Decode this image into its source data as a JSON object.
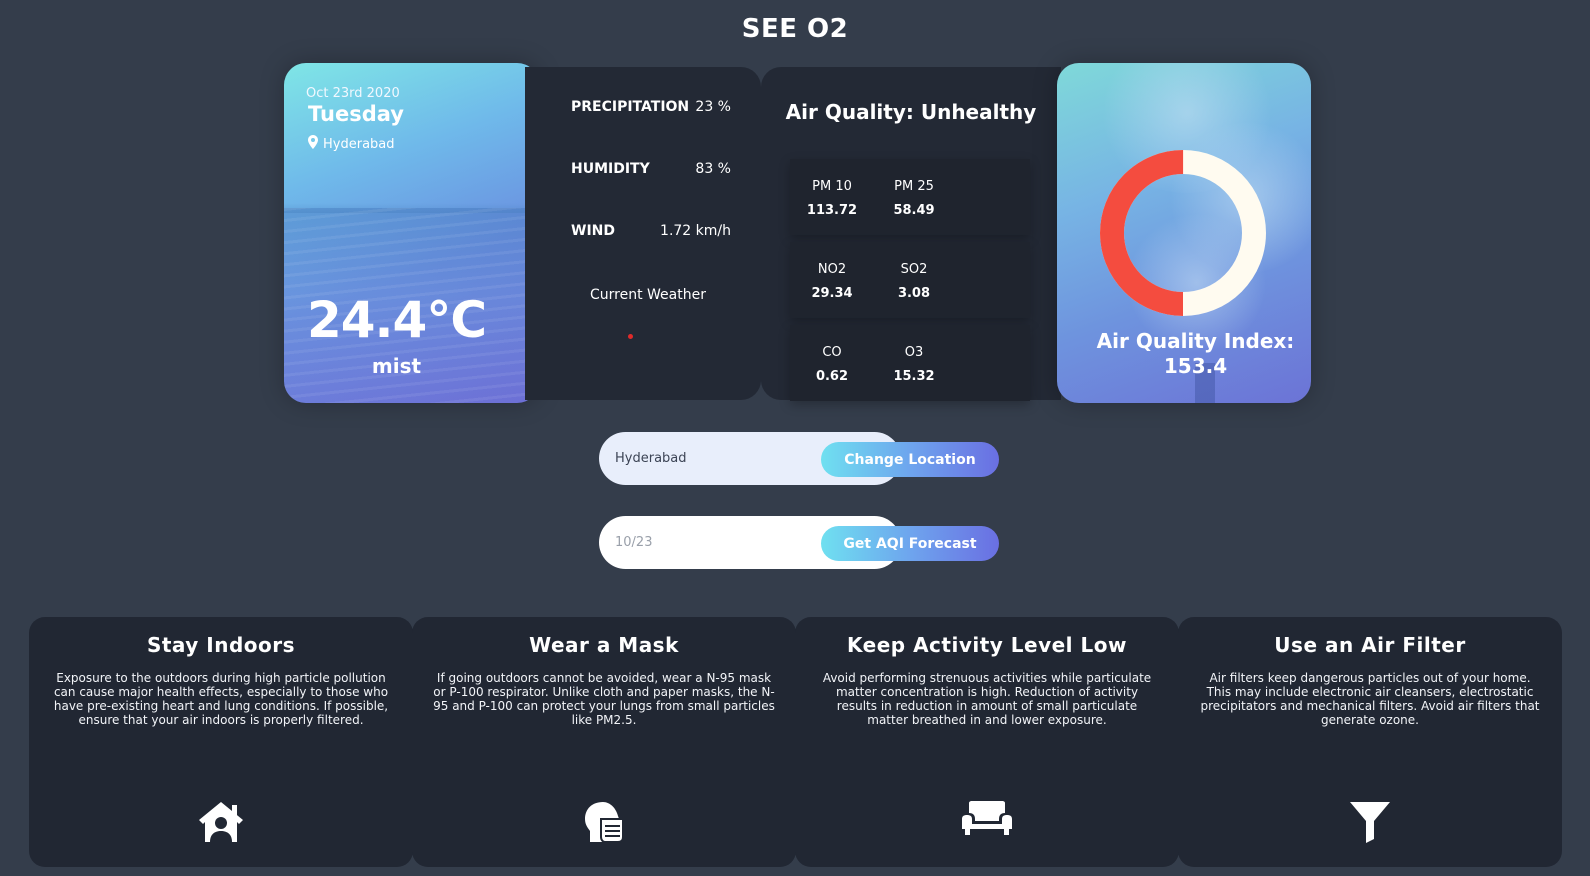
{
  "app": {
    "title": "SEE O2"
  },
  "weather": {
    "date": "Oct 23rd 2020",
    "day": "Tuesday",
    "location": "Hyderabad",
    "temperature": "24.4°C",
    "description": "mist"
  },
  "details": {
    "precipitation_label": "PRECIPITATION",
    "precipitation_value": "23 %",
    "humidity_label": "HUMIDITY",
    "humidity_value": "83 %",
    "wind_label": "WIND",
    "wind_value": "1.72 km/h",
    "current_weather_label": "Current Weather"
  },
  "air_quality": {
    "title": "Air Quality: Unhealthy",
    "pollutants": [
      {
        "name": "PM 10",
        "value": "113.72"
      },
      {
        "name": "PM 25",
        "value": "58.49"
      },
      {
        "name": "NO2",
        "value": "29.34"
      },
      {
        "name": "SO2",
        "value": "3.08"
      },
      {
        "name": "CO",
        "value": "0.62"
      },
      {
        "name": "O3",
        "value": "15.32"
      }
    ]
  },
  "aqi": {
    "label": "Air Quality Index:",
    "value": "153.4",
    "gauge_fraction": 0.5,
    "gauge_color": "#f44c3f",
    "gauge_track_color": "#fffbf0"
  },
  "location_form": {
    "value": "Hyderabad",
    "button_label": "Change Location"
  },
  "forecast_form": {
    "placeholder": "10/23",
    "button_label": "Get AQI Forecast"
  },
  "tips": [
    {
      "title": "Stay Indoors",
      "text": "Exposure to the outdoors during high particle pollution can cause major health effects, especially to those who have pre-existing heart and lung conditions. If possible, ensure that your air indoors is properly filtered.",
      "icon": "house-user-icon"
    },
    {
      "title": "Wear a Mask",
      "text": "If going outdoors cannot be avoided, wear a N-95 mask or P-100 respirator. Unlike cloth and paper masks, the N-95 and P-100 can protect your lungs from small particles like PM2.5.",
      "icon": "head-mask-icon"
    },
    {
      "title": "Keep Activity Level Low",
      "text": "Avoid performing strenuous activities while particulate matter concentration is high. Reduction of activity results in reduction in amount of small particulate matter breathed in and lower exposure.",
      "icon": "couch-icon"
    },
    {
      "title": "Use an Air Filter",
      "text": "Air filters keep dangerous particles out of your home. This may include electronic air cleansers, electrostatic precipitators and mechanical filters. Avoid air filters that generate ozone.",
      "icon": "filter-icon"
    }
  ]
}
